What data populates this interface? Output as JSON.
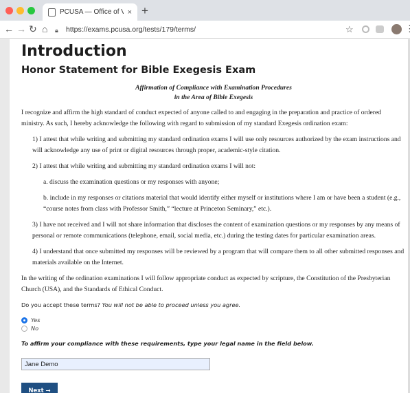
{
  "browser": {
    "tab_title": "PCUSA — Office of Vocation – ",
    "tab_close": "×",
    "new_tab": "+",
    "url": "https://exams.pcusa.org/tests/179/terms/"
  },
  "page": {
    "heading": "Introduction",
    "subheading": "Honor Statement for Bible Exegesis Exam",
    "affirmation_title_line1": "Affirmation of Compliance with Examination Procedures",
    "affirmation_title_line2": "in the Area of Bible Exegesis",
    "intro": "I recognize and affirm the high standard of conduct expected of anyone called to and engaging in the preparation and practice of ordered ministry.  As such, I hereby acknowledge the following with regard to submission of my standard Exegesis ordination exam:",
    "item1": "1) I attest that while writing and submitting my standard ordination exams I will use only resources authorized by the exam instructions and will acknowledge any use of print or digital resources through proper, academic-style citation.",
    "item2": "2) I attest that while writing and submitting my standard ordination exams I will not:",
    "item2a": "a. discuss the examination questions or my responses with anyone;",
    "item2b": "b. include in my responses or citations material that would identify either myself or institutions where I am or have been a student (e.g., “course notes from class with Professor Smith,” “lecture at Princeton Seminary,” etc.).",
    "item3": "3) I have not received and I will not share information that discloses the content of examination questions or my responses by any means of personal or remote communications (telephone, email, social media, etc.) during the testing dates for particular examination areas.",
    "item4": "4)  I understand that once submitted my responses will be reviewed by a program that will compare them to all other submitted responses and materials available on the Internet.",
    "closing": "In the writing of the ordination examinations I will follow appropriate conduct as expected by scripture, the Constitution of the Presbyterian Church (USA), and the Standards of Ethical Conduct.",
    "question": "Do you accept these terms?",
    "question_note": "You will not be able to proceed unless you agree.",
    "option_yes": "Yes",
    "option_no": "No",
    "selected": "Yes",
    "affirm_prompt": "To affirm your compliance with these requirements, type your legal name in the field below.",
    "legal_name_value": "Jane Demo",
    "next_label": "Next →"
  },
  "colors": {
    "accent_radio": "#1a73e8",
    "next_button": "#1f4f82",
    "input_fill": "#e8f0fe"
  }
}
